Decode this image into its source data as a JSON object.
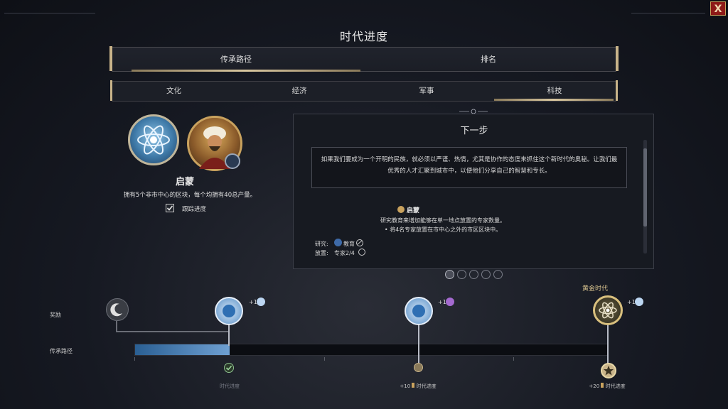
{
  "screen_title": "时代进度",
  "close_label": "X",
  "main_tabs": [
    {
      "label": "传承路径"
    },
    {
      "label": "排名"
    }
  ],
  "sub_tabs": [
    {
      "label": "文化"
    },
    {
      "label": "经济"
    },
    {
      "label": "军事"
    },
    {
      "label": "科技"
    }
  ],
  "milestone": {
    "name": "启蒙",
    "description": "拥有5个非市中心的区块，每个均拥有40总产量。",
    "track_label": "跟踪进度",
    "track_checked": true
  },
  "next_step": {
    "title": "下一步",
    "quote": "如果我们要成为一个开明的民族，就必须以严谨、热情，尤其是协作的态度来抓住这个新时代的奥秘。让我们最优秀的人才汇聚到城市中，以便他们分享自己的智慧和专长。",
    "task_title": "启蒙",
    "task_desc": "研究教育来增加能够在单一地点放置的专家数量。",
    "task_bullet": "• 将4名专家放置在市中心之外的市区区块中。",
    "research_label": "研究:",
    "research_value": "教育",
    "place_label": "放置:",
    "place_value": "专家2/4"
  },
  "pager_count": 5,
  "track": {
    "rewards_label": "奖励",
    "legacy_label": "传承路径",
    "golden_age_label": "黄金时代",
    "progress_fraction": 0.2,
    "rewards": [
      {
        "bonus": "+1"
      },
      {
        "bonus": "+1"
      },
      {
        "bonus": "+1"
      }
    ],
    "milestone_labels": [
      {
        "text": "时代进度"
      },
      {
        "amount": "+10",
        "text": "时代进度"
      },
      {
        "amount": "+20",
        "text": "时代进度"
      }
    ]
  },
  "colors": {
    "accent_gold": "#c9b48a",
    "progress_blue": "#4f86bd",
    "close_red": "#8e1a18"
  },
  "icons": [
    "atom-icon",
    "leader-portrait",
    "moon-icon",
    "specialist-icon",
    "check-icon",
    "star-icon"
  ]
}
